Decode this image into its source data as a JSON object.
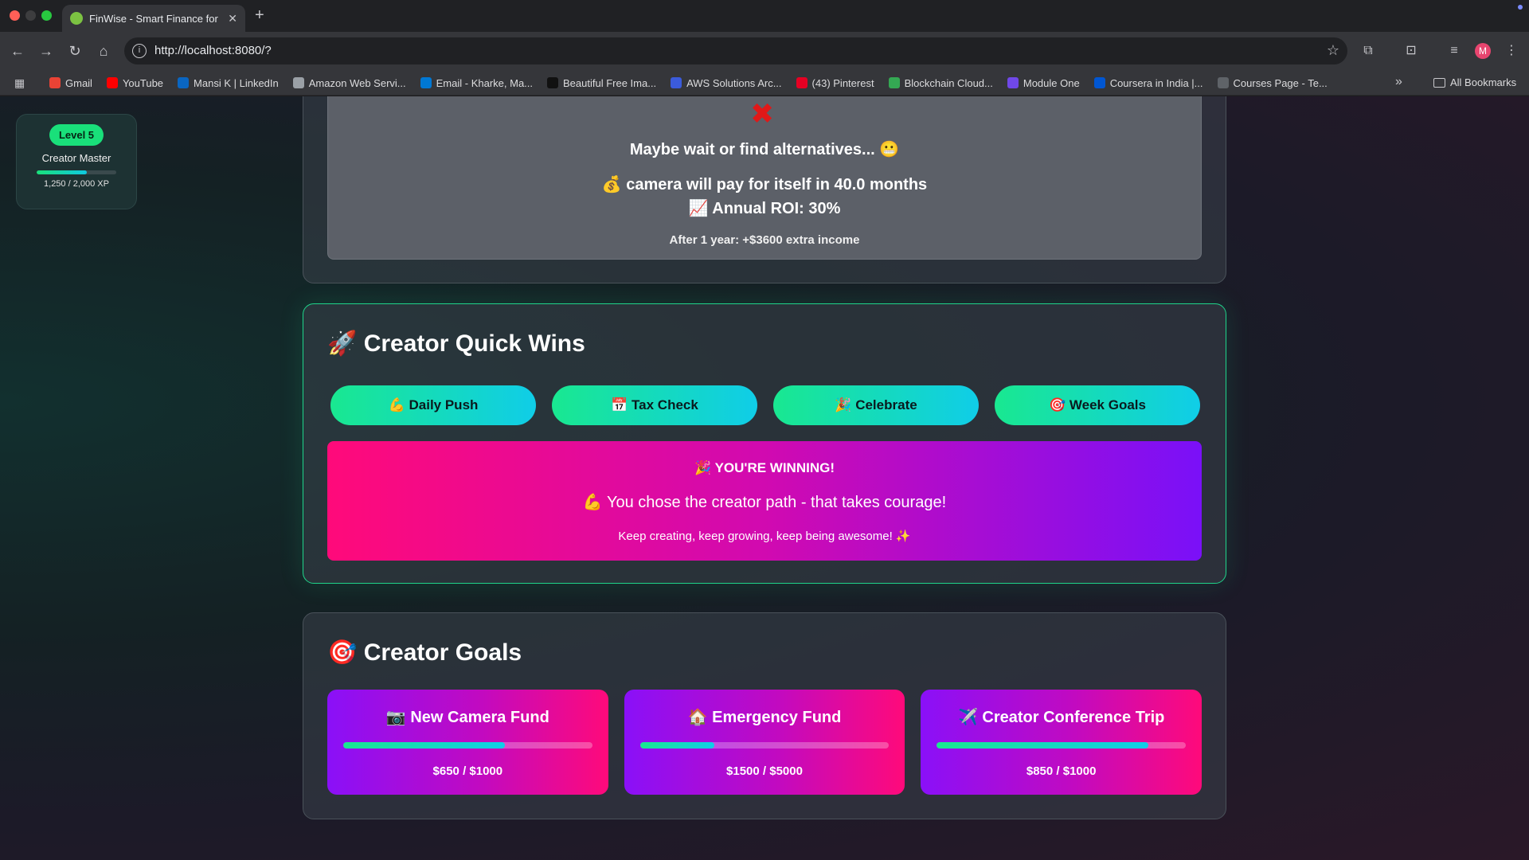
{
  "browser": {
    "tab_title": "FinWise - Smart Finance for C",
    "url": "http://localhost:8080/?",
    "avatar_initial": "M",
    "bookmarks": [
      {
        "label": "Gmail",
        "color": "#ea4335"
      },
      {
        "label": "YouTube",
        "color": "#ff0000"
      },
      {
        "label": "Mansi K | LinkedIn",
        "color": "#0a66c2"
      },
      {
        "label": "Amazon Web Servi...",
        "color": "#9aa0a6"
      },
      {
        "label": "Email - Kharke, Ma...",
        "color": "#0078d4"
      },
      {
        "label": "Beautiful Free Ima...",
        "color": "#111111"
      },
      {
        "label": "AWS Solutions Arc...",
        "color": "#3b5bdb"
      },
      {
        "label": "(43) Pinterest",
        "color": "#e60023"
      },
      {
        "label": "Blockchain Cloud...",
        "color": "#34a853"
      },
      {
        "label": "Module One",
        "color": "#7048e8"
      },
      {
        "label": "Coursera in India |...",
        "color": "#0056d2"
      },
      {
        "label": "Courses Page - Te...",
        "color": "#5f6368"
      }
    ],
    "all_bookmarks": "All Bookmarks"
  },
  "level": {
    "badge": "Level 5",
    "title": "Creator Master",
    "xp_text": "1,250 / 2,000 XP",
    "progress": 0.625
  },
  "roi": {
    "icon": "✖",
    "warning": "Maybe wait or find alternatives... 😬",
    "payback": "💰 camera will pay for itself in 40.0 months",
    "annual": "📈 Annual ROI: 30%",
    "after": "After 1 year: +$3600 extra income"
  },
  "quick_wins": {
    "title": "🚀 Creator Quick Wins",
    "buttons": [
      {
        "label": "💪 Daily Push"
      },
      {
        "label": "📅 Tax Check"
      },
      {
        "label": "🎉 Celebrate"
      },
      {
        "label": "🎯 Week Goals"
      }
    ],
    "banner": {
      "title": "🎉 YOU'RE WINNING!",
      "message": "💪 You chose the creator path - that takes courage!",
      "sub": "Keep creating, keep growing, keep being awesome! ✨"
    }
  },
  "goals": {
    "title": "🎯 Creator Goals",
    "items": [
      {
        "name": "📷 New Camera Fund",
        "amount": "$650 / $1000",
        "progress": 0.65
      },
      {
        "name": "🏠 Emergency Fund",
        "amount": "$1500 / $5000",
        "progress": 0.3
      },
      {
        "name": "✈️ Creator Conference Trip",
        "amount": "$850 / $1000",
        "progress": 0.85
      }
    ]
  }
}
